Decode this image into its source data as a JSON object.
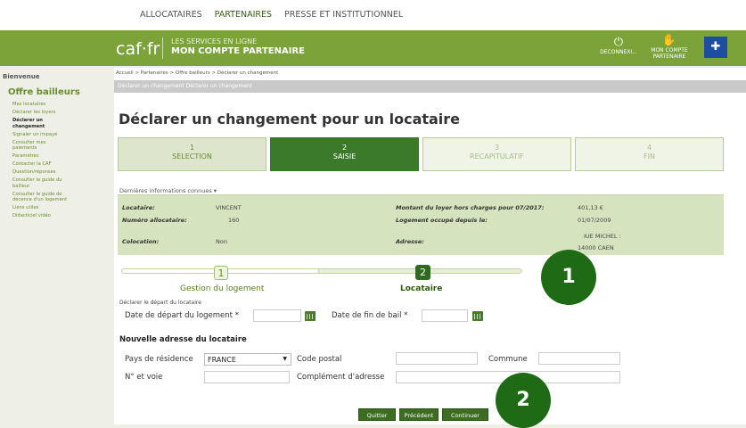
{
  "topnav": {
    "tabs": [
      "ALLOCATAIRES",
      "PARTENAIRES",
      "PRESSE ET INSTITUTIONNEL"
    ]
  },
  "banner": {
    "logo": "caf·fr",
    "services_line1": "LES SERVICES EN LIGNE",
    "services_line2": "MON COMPTE PARTENAIRE",
    "logout_label": "DECONNEXI...",
    "account_label": "MON COMPTE PARTENAIRE"
  },
  "sidebar": {
    "welcome": "Bienvenue",
    "title": "Offre bailleurs",
    "items": [
      "Mes locataires",
      "Déclarer les loyers",
      "Déclarer un changement",
      "Signaler un impayé",
      "Consulter mes paiements",
      "Paramètres",
      "Contacter la CAF",
      "Question/réponses",
      "Consulter le guide du bailleur",
      "Consulter le guide de décence d'un logement",
      "Liens utiles",
      "Didacticiel vidéo"
    ]
  },
  "breadcrumb": "Accueil > Partenaires > Offre bailleurs > Déclarer un changement",
  "titlebar": "Déclarer un changement Déclarer un changement",
  "page_title": "Déclarer un changement pour un locataire",
  "steps": [
    {
      "num": "1",
      "label": "SELECTION"
    },
    {
      "num": "2",
      "label": "SAISIE"
    },
    {
      "num": "3",
      "label": "RECAPITULATIF"
    },
    {
      "num": "4",
      "label": "FIN"
    }
  ],
  "info": {
    "heading": "Dernières informations connues ▾",
    "locataire_label": "Locataire:",
    "locataire_value": "VINCENT",
    "numero_label": "Numéro allocataire:",
    "numero_value": "160",
    "colocation_label": "Colocation:",
    "colocation_value": "Non",
    "montant_label": "Montant du loyer hors charges pour 07/2017:",
    "montant_value": "401,13 €",
    "occupe_label": "Logement occupé depuis le:",
    "occupe_value": "01/07/2009",
    "adresse_label": "Adresse:",
    "adresse_line1": "IUE MICHEL :",
    "adresse_line2": "14000 CAEN"
  },
  "progress": {
    "step1_num": "1",
    "step1_label": "Gestion du logement",
    "step2_num": "2",
    "step2_label": "Locataire"
  },
  "form": {
    "depart_heading": "Déclarer le départ du locataire",
    "date_depart_label": "Date de départ du logement *",
    "date_fin_bail_label": "Date de fin de bail *",
    "new_address_heading": "Nouvelle adresse du locataire",
    "pays_label": "Pays de résidence",
    "pays_value": "FRANCE",
    "code_postal_label": "Code postal",
    "commune_label": "Commune",
    "voie_label": "N° et voie",
    "complement_label": "Complément d'adresse"
  },
  "buttons": {
    "quit": "Quitter",
    "prev": "Précédent",
    "next": "Continuer"
  },
  "callouts": {
    "one": "1",
    "two": "2"
  }
}
